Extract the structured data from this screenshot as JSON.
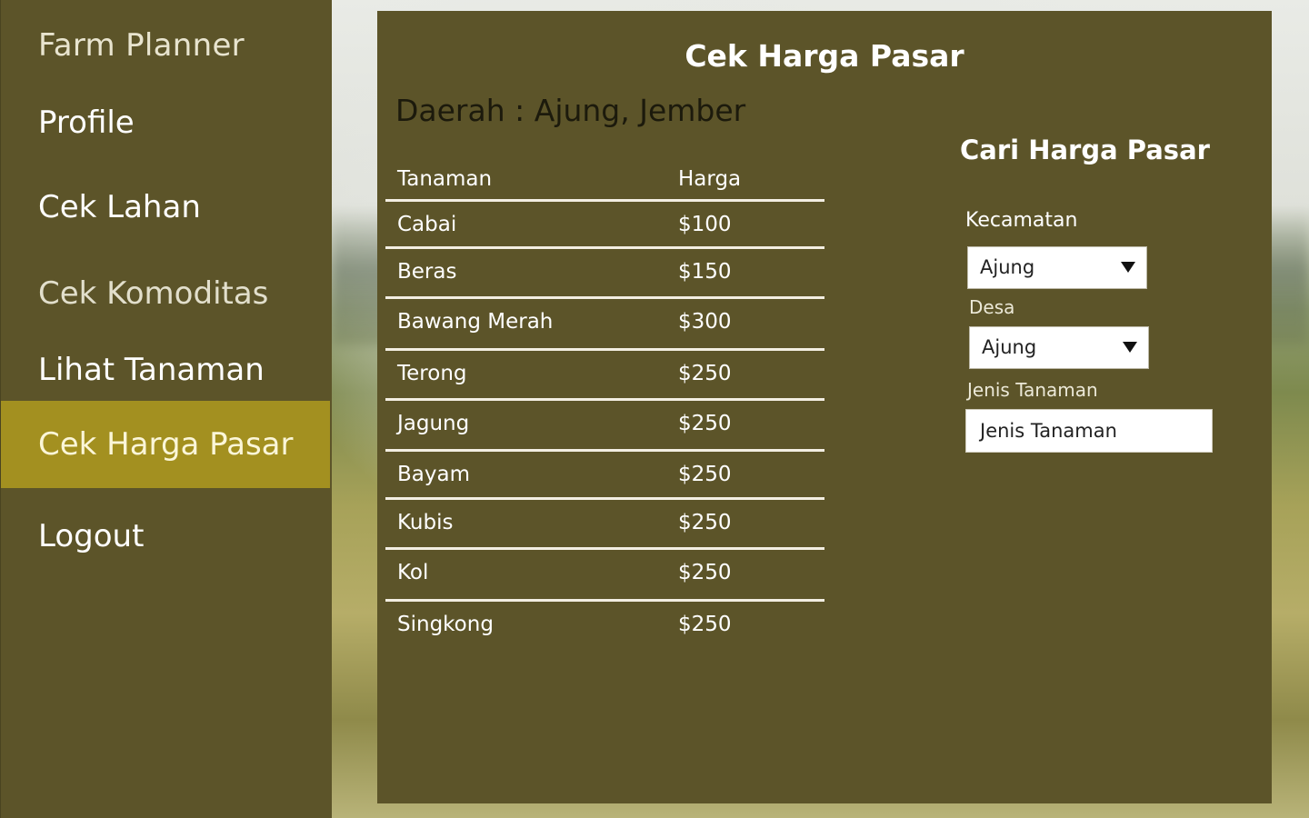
{
  "sidebar": {
    "app_title": "Farm Planner",
    "items": [
      {
        "label": "Profile"
      },
      {
        "label": "Cek Lahan"
      },
      {
        "label": "Cek Komoditas"
      },
      {
        "label": "Lihat Tanaman"
      },
      {
        "label": "Cek Harga Pasar",
        "active": true
      },
      {
        "label": "Logout"
      }
    ]
  },
  "main": {
    "title": "Cek Harga Pasar",
    "region": "Daerah : Ajung, Jember",
    "table": {
      "headers": [
        "Tanaman",
        "Harga"
      ],
      "rows": [
        [
          "Cabai",
          "$100"
        ],
        [
          "Beras",
          "$150"
        ],
        [
          "Bawang Merah",
          "$300"
        ],
        [
          "Terong",
          "$250"
        ],
        [
          "Jagung",
          "$250"
        ],
        [
          "Bayam",
          "$250"
        ],
        [
          "Kubis",
          "$250"
        ],
        [
          "Kol",
          "$250"
        ],
        [
          "Singkong",
          "$250"
        ]
      ]
    }
  },
  "search": {
    "title": "Cari Harga Pasar",
    "kecamatan_label": "Kecamatan",
    "kecamatan_value": "Ajung",
    "desa_label": "Desa",
    "desa_value": "Ajung",
    "jenis_label": "Jenis Tanaman",
    "jenis_value": "Jenis Tanaman"
  },
  "colors": {
    "panel": "#5c5429",
    "active_nav": "#a39020"
  }
}
